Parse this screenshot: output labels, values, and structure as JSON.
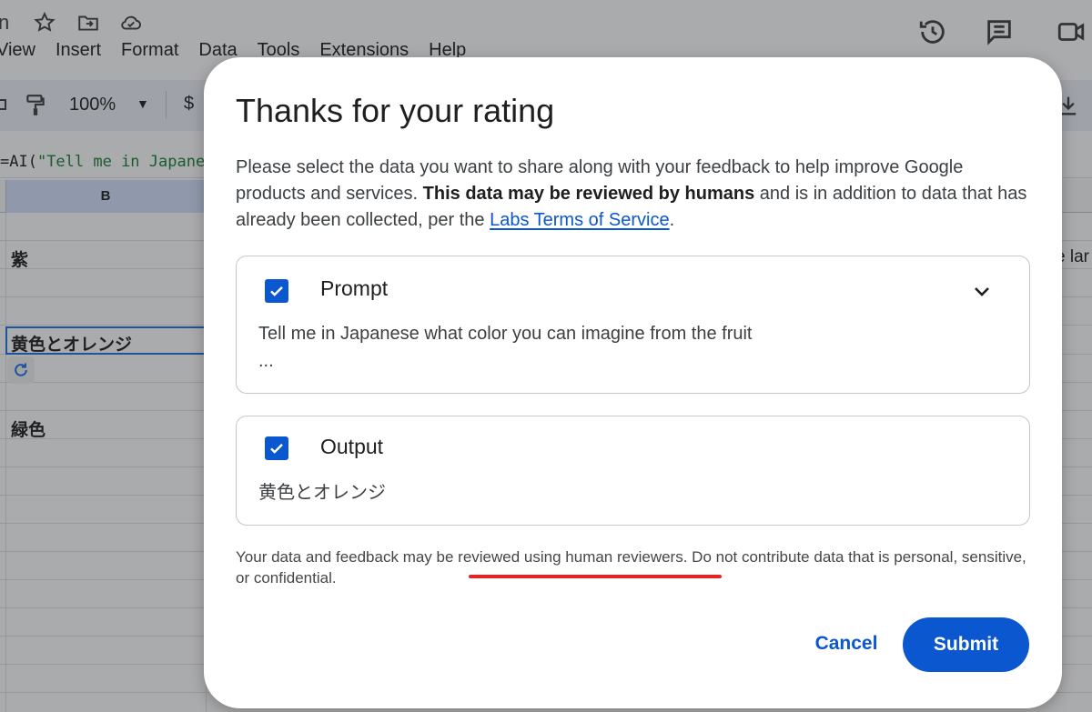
{
  "spreadsheet": {
    "title_fragment": "n",
    "menu": [
      "View",
      "Insert",
      "Format",
      "Data",
      "Tools",
      "Extensions",
      "Help"
    ],
    "zoom": "100%",
    "currency_symbol": "$",
    "formula_prefix": "=AI(",
    "formula_string": "\"Tell me in Japane",
    "column_header": "B",
    "cells": [
      "紫",
      "黄色とオレンジ",
      "緑色"
    ],
    "edge_text": "e lar"
  },
  "dialog": {
    "title": "Thanks for your rating",
    "desc_part1": "Please select the data you want to share along with your feedback to help improve Google products and services. ",
    "desc_bold": "This data may be reviewed by humans",
    "desc_part2": " and is in addition to data that has already been collected, per the ",
    "desc_link": "Labs Terms of Service",
    "desc_end": ".",
    "prompt_card": {
      "label": "Prompt",
      "checked": true,
      "text_line1": "Tell me in Japanese what color you can imagine from the fruit",
      "text_line2": "..."
    },
    "output_card": {
      "label": "Output",
      "checked": true,
      "text": "黄色とオレンジ"
    },
    "disclaimer": "Your data and feedback may be reviewed using human reviewers. Do not contribute data that is personal, sensitive, or confidential.",
    "cancel_label": "Cancel",
    "submit_label": "Submit"
  },
  "colors": {
    "accent": "#0b57d0",
    "highlight_underline": "#e32424"
  }
}
